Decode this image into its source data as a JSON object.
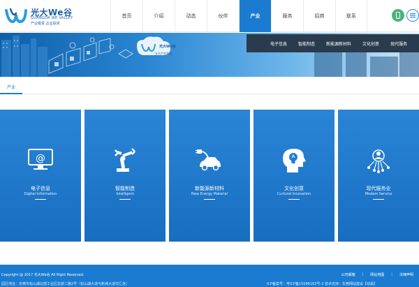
{
  "logo": {
    "cn": "光大We谷",
    "en": "GUANGDA WE VALLEY",
    "sub": "产业租赁  企业投资"
  },
  "nav": {
    "items": [
      "首页",
      "介绍",
      "动态",
      "伙伴",
      "产业",
      "服务",
      "招商",
      "联系"
    ],
    "active_index": 4
  },
  "banner": {
    "logo_cn": "光大We谷",
    "logo_sub": "五大产业花园"
  },
  "subnav": {
    "items": [
      "电子信息",
      "智能制造",
      "新能源新材料",
      "文化创意",
      "现代服务"
    ]
  },
  "tabs": {
    "current": "产业"
  },
  "cards": [
    {
      "title": "电子信息",
      "subtitle": "Digital Information",
      "icon": "monitor-at-icon"
    },
    {
      "title": "智能制造",
      "subtitle": "Intelligent",
      "icon": "robot-arm-icon"
    },
    {
      "title": "新能源新材料",
      "subtitle": "New Energy Material",
      "icon": "electric-car-icon"
    },
    {
      "title": "文化创意",
      "subtitle": "Curtural Innovation",
      "icon": "head-bulb-icon"
    },
    {
      "title": "现代服务业",
      "subtitle": "Modem Service",
      "icon": "network-person-icon"
    }
  ],
  "footer": {
    "copyright": "Copyright @ 2017 光大We谷 All Right Reserved.",
    "address": "园区地址：东莞市松山湖北部工业区总部二路2号（松山湖大道与新城大道交汇处）",
    "links": [
      "公司邮箱",
      "网站地图",
      "法律声明"
    ],
    "icp": "ICP备案号：粤ICP备15088182号-2  技术支持：东莞网站建设【动易】"
  },
  "colors": {
    "brand_blue": "#1a7bd0",
    "subnav_bg": "#2a3b4d"
  }
}
